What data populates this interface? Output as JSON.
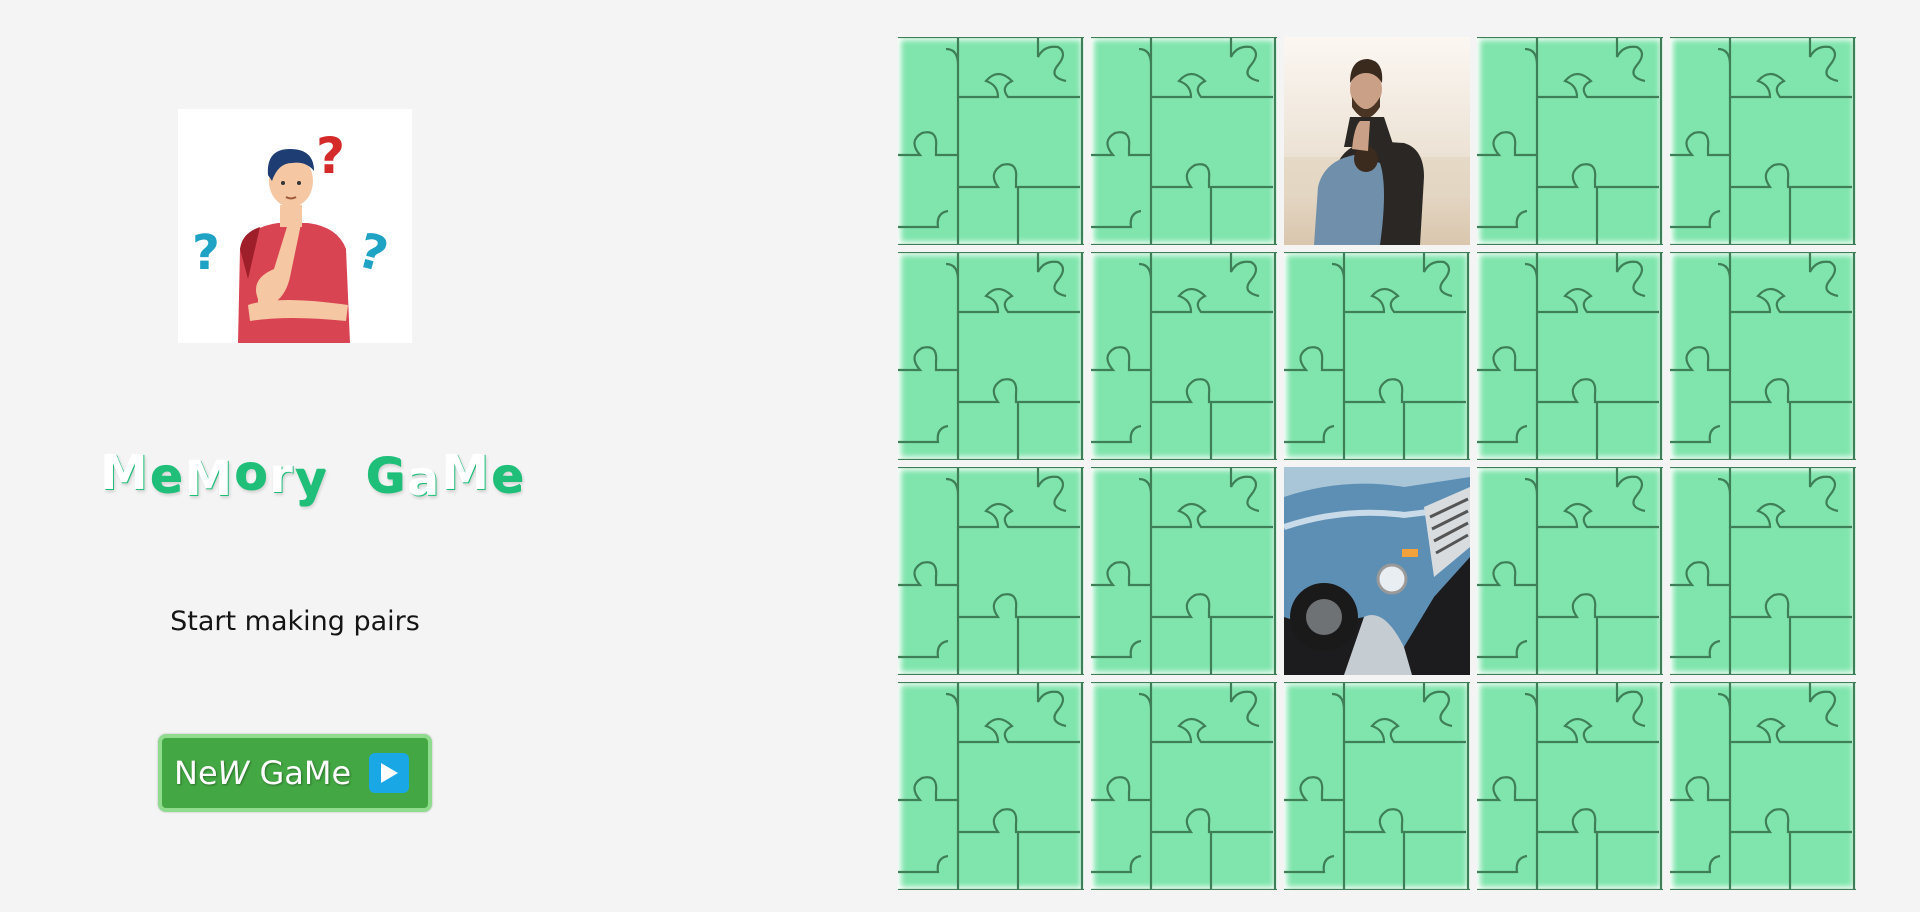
{
  "sidebar": {
    "title_letters": [
      {
        "char": "M",
        "color": "#ffffff"
      },
      {
        "char": "e",
        "color": "#1fbf7a"
      },
      {
        "char": "M",
        "color": "#ffffff"
      },
      {
        "char": "o",
        "color": "#1fbf7a"
      },
      {
        "char": "r",
        "color": "#ffffff"
      },
      {
        "char": "y",
        "color": "#1fbf7a"
      },
      {
        "char": " ",
        "color": "#ffffff"
      },
      {
        "char": "G",
        "color": "#1fbf7a"
      },
      {
        "char": "a",
        "color": "#ffffff"
      },
      {
        "char": "M",
        "color": "#ffffff"
      },
      {
        "char": "e",
        "color": "#1fbf7a"
      }
    ],
    "subtitle": "Start making pairs",
    "new_game_button": {
      "label_prefix": "Ne",
      "label_italic": "W",
      "label_suffix": " GaMe",
      "icon": "play-icon"
    }
  },
  "board": {
    "rows": 4,
    "cols": 5,
    "card_back": "puzzle-pattern",
    "cards": [
      "hidden",
      "hidden",
      "photo-couple",
      "hidden",
      "hidden",
      "hidden",
      "hidden",
      "hidden",
      "hidden",
      "hidden",
      "hidden",
      "hidden",
      "photo-truck",
      "hidden",
      "hidden",
      "hidden",
      "hidden",
      "hidden",
      "hidden",
      "hidden"
    ]
  },
  "colors": {
    "background": "#f4f4f4",
    "card_back": "#80e5ad",
    "button": "#43a843",
    "button_border": "#8fdc8f",
    "accent": "#1fbf7a"
  }
}
